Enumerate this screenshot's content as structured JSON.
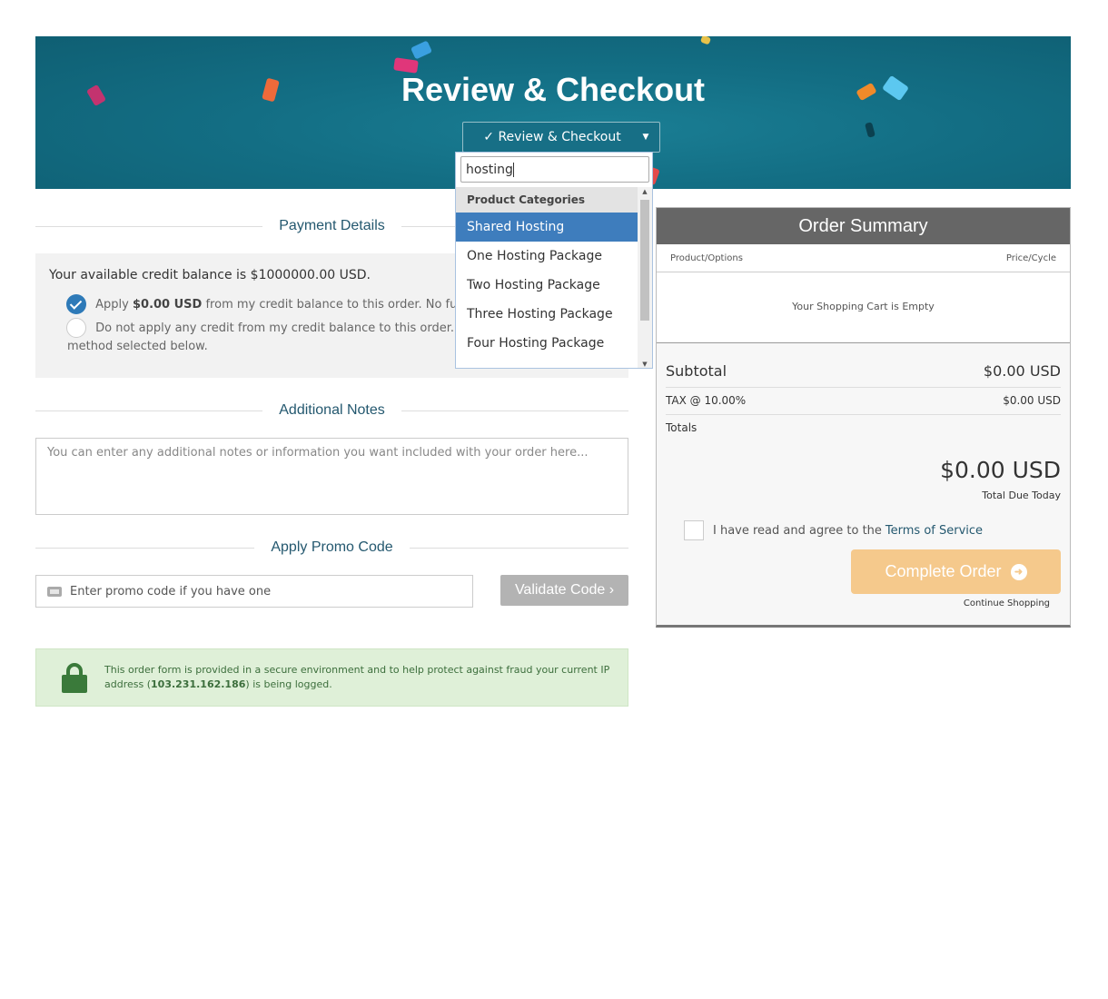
{
  "banner": {
    "title": "Review & Checkout",
    "nav_select_label": "✓ Review & Checkout"
  },
  "dropdown": {
    "search_value": "hosting",
    "group_label": "Product Categories",
    "options": [
      "Shared Hosting",
      "One Hosting Package",
      "Two Hosting Package",
      "Three Hosting Package",
      "Four Hosting Package"
    ],
    "active_option": "Shared Hosting"
  },
  "payment": {
    "heading": "Payment Details",
    "balance_text": "Your available credit balance is $1000000.00 USD.",
    "apply_prefix": "Apply ",
    "apply_amount": "$0.00 USD",
    "apply_suffix": " from my credit balance to this order. No further pa",
    "noapply_line1": "Do not apply any credit from my credit balance to this order. I will pa",
    "noapply_line2": "method selected below."
  },
  "notes": {
    "heading": "Additional Notes",
    "placeholder": "You can enter any additional notes or information you want included with your order here..."
  },
  "promo": {
    "heading": "Apply Promo Code",
    "placeholder": "Enter promo code if you have one",
    "validate_label": "Validate Code ›"
  },
  "secure": {
    "text_prefix": "This order form is provided in a secure environment and to help protect against fraud your current IP address (",
    "ip": "103.231.162.186",
    "text_suffix": ") is being logged."
  },
  "summary": {
    "title": "Order Summary",
    "col_product": "Product/Options",
    "col_price": "Price/Cycle",
    "empty_text": "Your Shopping Cart is Empty",
    "subtotal_label": "Subtotal",
    "subtotal_value": "$0.00 USD",
    "tax_label": "TAX @ 10.00%",
    "tax_value": "$0.00 USD",
    "totals_label": "Totals",
    "total_amount": "$0.00 USD",
    "total_due_label": "Total Due Today",
    "tos_text": "I have read and agree to the",
    "tos_link": "Terms of Service",
    "complete_label": "Complete Order",
    "continue_label": "Continue Shopping"
  },
  "colors": {
    "banner": "#136e84",
    "accent_blue": "#2e7ab8",
    "complete_button": "#f5c98c",
    "summary_header": "#666666",
    "secure_bg": "#dff0d8"
  }
}
